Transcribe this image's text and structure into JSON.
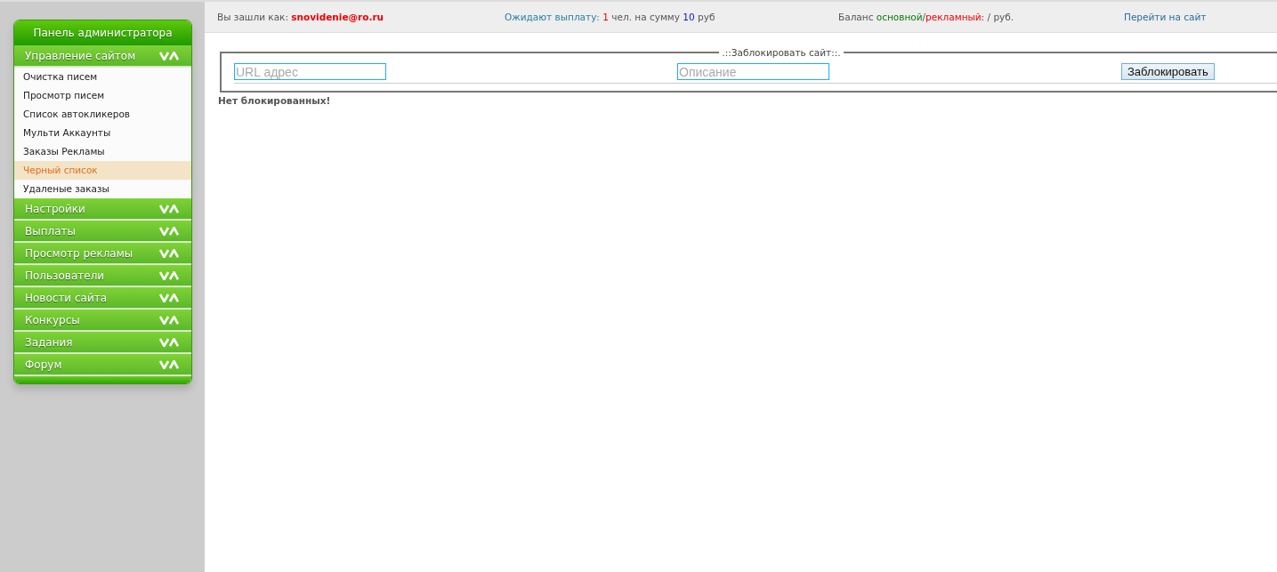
{
  "sidebar": {
    "title": "Панель администратора",
    "sections": [
      {
        "label": "Управление сайтом",
        "items": [
          {
            "label": "Очистка писем",
            "selected": false
          },
          {
            "label": "Просмотр писем",
            "selected": false
          },
          {
            "label": "Список автокликеров",
            "selected": false
          },
          {
            "label": "Мульти Аккаунты",
            "selected": false
          },
          {
            "label": "Заказы Рекламы",
            "selected": false
          },
          {
            "label": "Черный список",
            "selected": true
          },
          {
            "label": "Удаленые заказы",
            "selected": false
          }
        ]
      },
      {
        "label": "Настройки"
      },
      {
        "label": "Выплаты"
      },
      {
        "label": "Просмотр рекламы"
      },
      {
        "label": "Пользователи"
      },
      {
        "label": "Новости сайта"
      },
      {
        "label": "Конкурсы"
      },
      {
        "label": "Задания"
      },
      {
        "label": "Форум"
      }
    ]
  },
  "top_bar": {
    "login_label": "Вы зашли как:",
    "login_email": "snovidenie@ro.ru",
    "pending_label": "Ожидают выплату:",
    "pending_count": "1",
    "pending_mid": "чел. на сумму",
    "pending_sum": "10",
    "pending_unit": "руб",
    "balance_label": "Баланс",
    "balance_main": "основной",
    "balance_sep": "/",
    "balance_ads": "рекламный:",
    "balance_value": "/ руб.",
    "site_link": "Перейти на сайт"
  },
  "block_form": {
    "legend": ".::Заблокировать сайт::.",
    "url_placeholder": "URL адрес",
    "description_placeholder": "Описание",
    "submit": "Заблокировать"
  },
  "empty_message": "Нет блокированных!"
}
